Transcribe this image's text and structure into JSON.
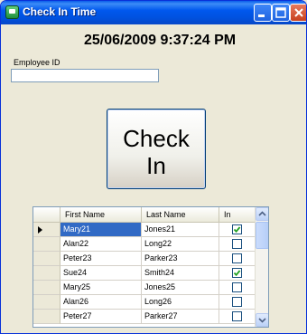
{
  "window": {
    "title": "Check In Time",
    "icon": "app-icon"
  },
  "clock": {
    "datetime": "25/06/2009 9:37:24 PM"
  },
  "employee": {
    "label": "Employee ID",
    "value": "",
    "placeholder": ""
  },
  "check_button": {
    "line1": "Check",
    "line2": "In"
  },
  "grid": {
    "columns": [
      "First Name",
      "Last Name",
      "In"
    ],
    "current_row": 0,
    "rows": [
      {
        "first": "Mary21",
        "last": "Jones21",
        "in": true
      },
      {
        "first": "Alan22",
        "last": "Long22",
        "in": false
      },
      {
        "first": "Peter23",
        "last": "Parker23",
        "in": false
      },
      {
        "first": "Sue24",
        "last": "Smith24",
        "in": true
      },
      {
        "first": "Mary25",
        "last": "Jones25",
        "in": false
      },
      {
        "first": "Alan26",
        "last": "Long26",
        "in": false
      },
      {
        "first": "Peter27",
        "last": "Parker27",
        "in": false
      }
    ]
  },
  "colors": {
    "titlebar": "#0054E3",
    "selection": "#316AC5",
    "checkmark": "#21A121",
    "window_bg": "#ECE9D8"
  }
}
